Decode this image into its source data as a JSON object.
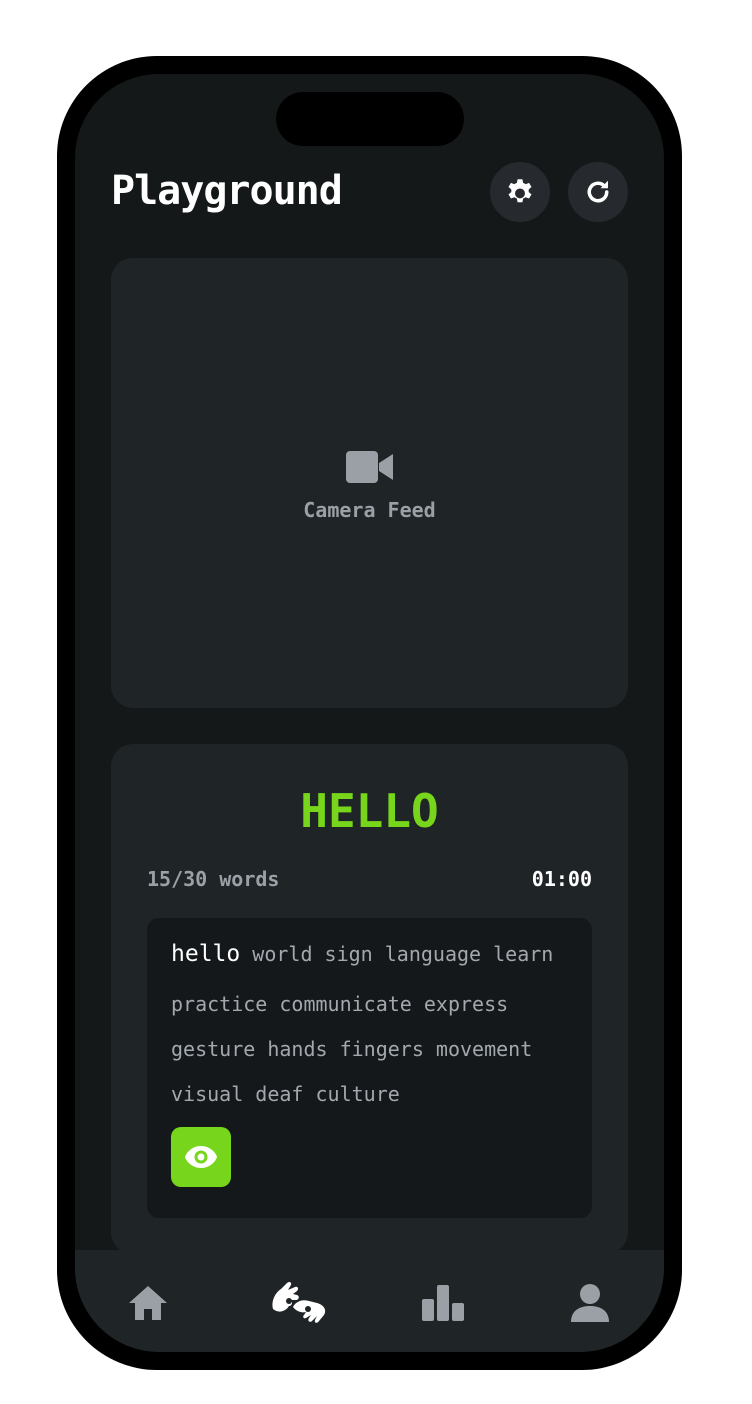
{
  "header": {
    "title": "Playground",
    "settings_icon": "gear-icon",
    "refresh_icon": "refresh-icon"
  },
  "camera": {
    "icon": "video-camera-icon",
    "label": "Camera Feed"
  },
  "game": {
    "target_word": "HELLO",
    "word_count": "15/30 words",
    "timer": "01:00",
    "current_word": "hello",
    "lines": [
      "world sign language learn",
      "practice communicate express",
      "gesture hands fingers movement",
      "visual deaf culture"
    ],
    "reveal_icon": "eye-icon"
  },
  "nav": {
    "items": [
      {
        "icon": "home-icon",
        "active": false
      },
      {
        "icon": "sign-language-icon",
        "active": true
      },
      {
        "icon": "bar-chart-icon",
        "active": false
      },
      {
        "icon": "user-icon",
        "active": false
      }
    ]
  },
  "colors": {
    "accent": "#77d61b",
    "background": "#151819",
    "card": "#1f2427",
    "muted_text": "#9aa0a6"
  }
}
